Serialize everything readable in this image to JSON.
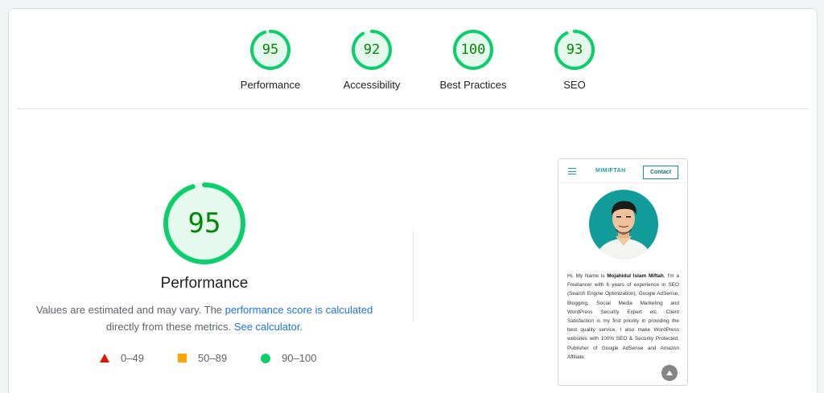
{
  "colors": {
    "pass": "#0cce6b",
    "pass_text": "#008800",
    "average": "#ffa400",
    "fail": "#eb0f00",
    "link": "#1a73e8",
    "brand": "#1aa0a3"
  },
  "gauges": [
    {
      "score": "95",
      "value": 95,
      "label": "Performance"
    },
    {
      "score": "92",
      "value": 92,
      "label": "Accessibility"
    },
    {
      "score": "100",
      "value": 100,
      "label": "Best Practices"
    },
    {
      "score": "93",
      "value": 93,
      "label": "SEO"
    }
  ],
  "main": {
    "score": "95",
    "value": 95,
    "title": "Performance",
    "desc_pre": "Values are estimated and may vary. The ",
    "desc_link1": "performance score is calculated",
    "desc_mid": "directly from these metrics. ",
    "desc_link2": "See calculator",
    "desc_end": "."
  },
  "legend": {
    "fail": {
      "icon": "triangle-icon",
      "label": "0–49"
    },
    "average": {
      "icon": "square-icon",
      "label": "50–89"
    },
    "pass": {
      "icon": "circle-icon",
      "label": "90–100"
    }
  },
  "screenshot": {
    "logo": "MIMIFTAH",
    "contact": "Contact",
    "menu_icon": "hamburger-icon",
    "scroll_icon": "arrow-up-icon",
    "text_1": "Hi, My Name is ",
    "text_name": "Mojahidul Islam Miftah",
    "text_2": ". I'm a Freelancer with 6 years of experience in SEO (Search Engine Optimization), Google AdSense, Blogging, Social Media Marketing and WordPress Security Expert etc. Client Satisfaction is my first priority in providing the best quality service. I also make WordPress websites with 100% SEO & Security Protected. Publisher of Google AdSense and Amazon Affiliate."
  }
}
